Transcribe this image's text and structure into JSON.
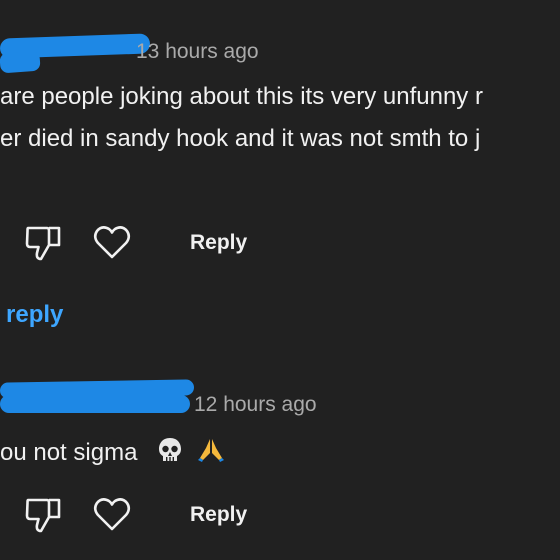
{
  "comment1": {
    "timestamp": "13 hours ago",
    "lines": [
      "are people joking about this its very unfunny r",
      "er died in sandy hook and it was not smth to j"
    ],
    "reply_label": "Reply",
    "replies_link": "1 reply"
  },
  "comment2": {
    "timestamp": "12 hours ago",
    "text": "ou not sigma",
    "emoji": [
      "skull-icon",
      "praying-hands-icon"
    ],
    "reply_label": "Reply"
  },
  "colors": {
    "background": "#212121",
    "text": "#f1f1f1",
    "meta": "#aaaaaa",
    "link": "#3ea6ff",
    "redaction": "#1e88e5"
  }
}
